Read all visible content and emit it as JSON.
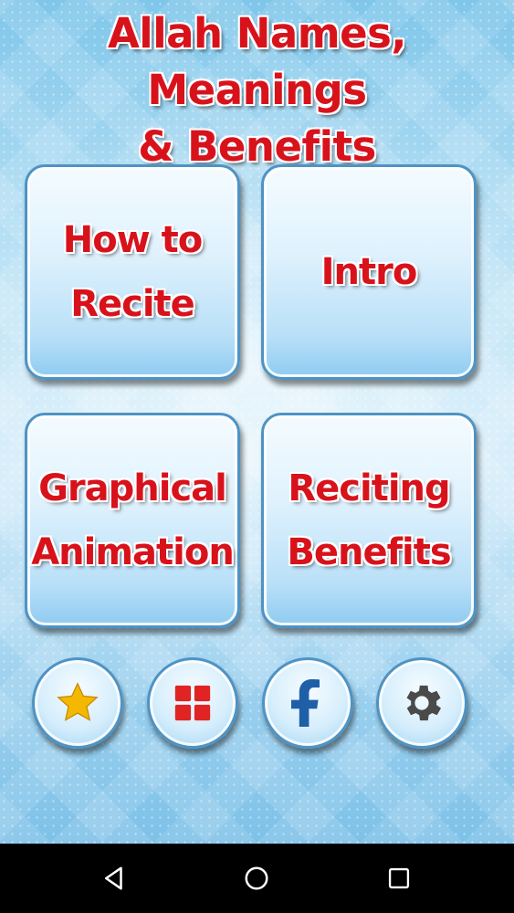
{
  "header": {
    "title_line1": "Allah Names, Meanings",
    "title_line2": "& Benefits"
  },
  "tiles": [
    {
      "line1": "How to",
      "line2": "Recite"
    },
    {
      "line1": "Intro",
      "line2": ""
    },
    {
      "line1": "Graphical",
      "line2": "Animation"
    },
    {
      "line1": "Reciting",
      "line2": "Benefits"
    }
  ],
  "bottom_buttons": [
    {
      "icon": "star-icon"
    },
    {
      "icon": "apps-grid-icon"
    },
    {
      "icon": "facebook-icon"
    },
    {
      "icon": "gear-icon"
    }
  ],
  "navbar": {
    "buttons": [
      "back-icon",
      "home-icon",
      "recents-icon"
    ]
  },
  "colors": {
    "title_red": "#d8121b",
    "tile_border": "#4e93c4",
    "star_gold": "#f5b800",
    "grid_red": "#e02424",
    "facebook_blue": "#1f5fa8",
    "gear_gray": "#4a4a4a"
  }
}
